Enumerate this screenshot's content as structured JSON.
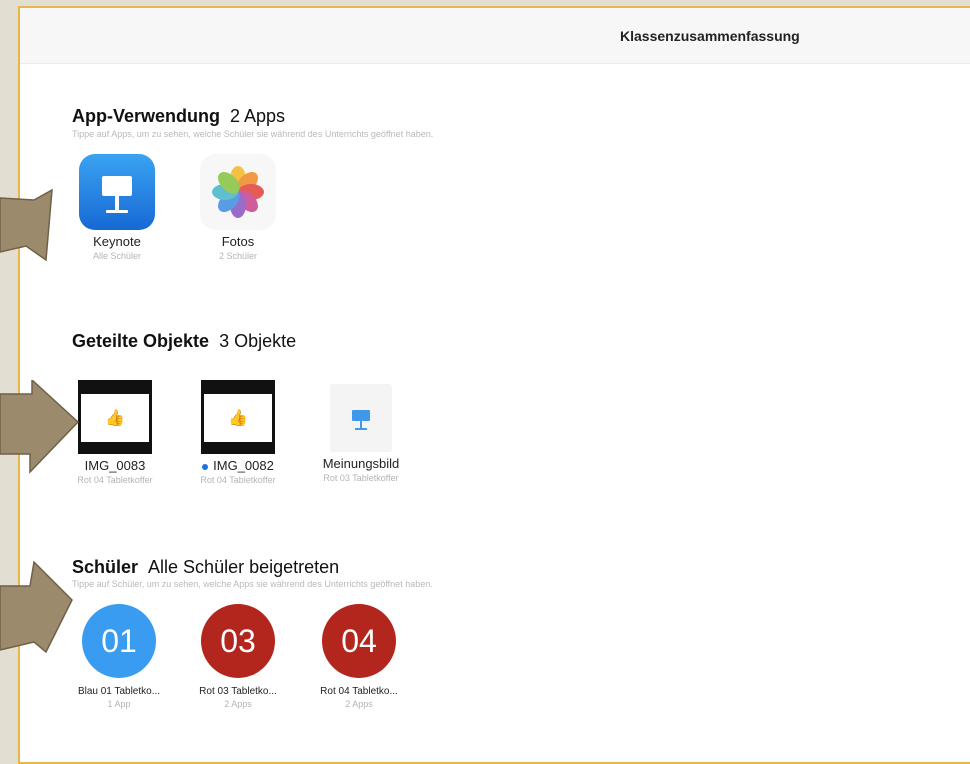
{
  "navbar": {
    "title": "Klassenzusammenfassung"
  },
  "apps": {
    "title": "App-Verwendung",
    "count": "2 Apps",
    "hint": "Tippe auf Apps, um zu sehen, welche Schüler sie während des Unterrichts geöffnet haben.",
    "items": [
      {
        "name": "Keynote",
        "sub": "Alle Schüler",
        "icon": "keynote-icon"
      },
      {
        "name": "Fotos",
        "sub": "2 Schüler",
        "icon": "photos-icon"
      }
    ]
  },
  "shared": {
    "title": "Geteilte Objekte",
    "count": "3 Objekte",
    "items": [
      {
        "name": "IMG_0083",
        "sub": "Rot 04 Tabletkoffer",
        "icon": "image-thumbnail"
      },
      {
        "name": "IMG_0082",
        "sub": "Rot 04 Tabletkoffer",
        "icon": "image-thumbnail",
        "unread": true
      },
      {
        "name": "Meinungsbild",
        "sub": "Rot 03 Tabletkoffer",
        "icon": "keynote-document-icon"
      }
    ]
  },
  "students": {
    "title": "Schüler",
    "status": "Alle Schüler beigetreten",
    "hint": "Tippe auf Schüler, um zu sehen, welche Apps sie während des Unterrichts geöffnet haben.",
    "items": [
      {
        "initials": "01",
        "name": "Blau 01 Tabletko...",
        "sub": "1 App",
        "color": "#3a9cf0"
      },
      {
        "initials": "03",
        "name": "Rot 03 Tabletko...",
        "sub": "2 Apps",
        "color": "#b3261e"
      },
      {
        "initials": "04",
        "name": "Rot 04 Tabletko...",
        "sub": "2 Apps",
        "color": "#b3261e"
      }
    ]
  },
  "colors": {
    "arrow": "#9c8a6c",
    "frame": "#e8b64a",
    "background": "#e2ded2",
    "unread_dot": "#1e6fe0"
  }
}
